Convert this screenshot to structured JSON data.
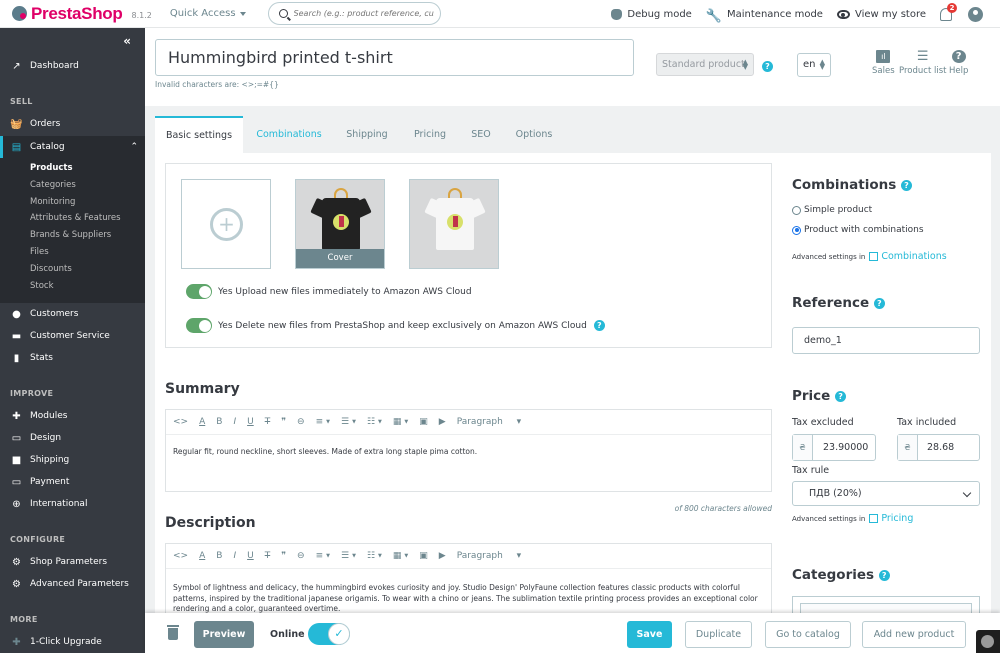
{
  "topbar": {
    "brand": "PrestaShop",
    "version": "8.1.2",
    "quick_access": "Quick Access",
    "search_placeholder": "Search (e.g.: product reference, custon",
    "debug_mode": "Debug mode",
    "maintenance_mode": "Maintenance mode",
    "view_store": "View my store",
    "notification_count": "2"
  },
  "sidebar": {
    "collapse_icon": "«",
    "dashboard": "Dashboard",
    "sections": {
      "sell": "SELL",
      "improve": "IMPROVE",
      "configure": "CONFIGURE",
      "more": "MORE"
    },
    "sell_items": [
      {
        "label": "Orders",
        "icon": "basket-icon"
      },
      {
        "label": "Catalog",
        "icon": "store-icon"
      },
      {
        "label": "Customers",
        "icon": "user-circle-icon"
      },
      {
        "label": "Customer Service",
        "icon": "chat-icon"
      },
      {
        "label": "Stats",
        "icon": "bar-chart-icon"
      }
    ],
    "catalog_sub": [
      "Products",
      "Categories",
      "Monitoring",
      "Attributes & Features",
      "Brands & Suppliers",
      "Files",
      "Discounts",
      "Stock"
    ],
    "improve_items": [
      "Modules",
      "Design",
      "Shipping",
      "Payment",
      "International"
    ],
    "configure_items": [
      "Shop Parameters",
      "Advanced Parameters"
    ],
    "more_items": [
      "1-Click Upgrade"
    ]
  },
  "header": {
    "product_name": "Hummingbird printed t-shirt",
    "invalid_chars": "Invalid characters are: <>;=#{}",
    "product_type": "Standard product",
    "language": "en",
    "buttons": {
      "sales": "Sales",
      "product_list": "Product list",
      "help": "Help"
    }
  },
  "tabs": [
    {
      "label": "Basic settings",
      "state": "active"
    },
    {
      "label": "Combinations",
      "state": "highlight"
    },
    {
      "label": "Shipping",
      "state": "normal"
    },
    {
      "label": "Pricing",
      "state": "normal"
    },
    {
      "label": "SEO",
      "state": "normal"
    },
    {
      "label": "Options",
      "state": "normal"
    }
  ],
  "media": {
    "add_icon": "+",
    "cover_label": "Cover",
    "images": [
      "black t-shirt",
      "white t-shirt"
    ],
    "switches": [
      {
        "label": "Yes Upload new files immediately to Amazon AWS Cloud",
        "on": true
      },
      {
        "label": "Yes Delete new files from PrestaShop and keep exclusively on Amazon AWS Cloud",
        "on": true
      }
    ]
  },
  "editor_toolbar": {
    "paragraph": "Paragraph"
  },
  "summary": {
    "title": "Summary",
    "text": "Regular fit, round neckline, short sleeves. Made of extra long staple pima cotton.",
    "limit": "of 800 characters allowed"
  },
  "description": {
    "title": "Description",
    "text": "Symbol of lightness and delicacy, the hummingbird evokes curiosity and joy. Studio Design' PolyFaune collection features classic products with colorful patterns, inspired by the traditional japanese origamis. To wear with a chino or jeans. The sublimation textile printing process provides an exceptional color rendering and a color, guaranteed overtime."
  },
  "right": {
    "combinations_title": "Combinations",
    "simple_product": "Simple product",
    "with_combinations": "Product with combinations",
    "selected": "with_combinations",
    "advanced_in": "Advanced settings in",
    "combinations_link": "Combinations",
    "reference_title": "Reference",
    "reference_value": "demo_1",
    "price_title": "Price",
    "tax_excluded_label": "Tax excluded",
    "tax_included_label": "Tax included",
    "currency": "₴",
    "tax_excluded_value": "23.90000",
    "tax_included_value": "28.68",
    "tax_rule_label": "Tax rule",
    "tax_rule_value": "ПДВ (20%)",
    "pricing_link": "Pricing",
    "categories_title": "Categories"
  },
  "footer": {
    "preview": "Preview",
    "online": "Online",
    "online_state": true,
    "save": "Save",
    "duplicate": "Duplicate",
    "go_to_catalog": "Go to catalog",
    "add_new_product": "Add new product"
  },
  "colors": {
    "accent": "#25b9d7",
    "brand": "#df0067",
    "sidebar": "#363a41",
    "switch_on": "#5ea56a"
  }
}
